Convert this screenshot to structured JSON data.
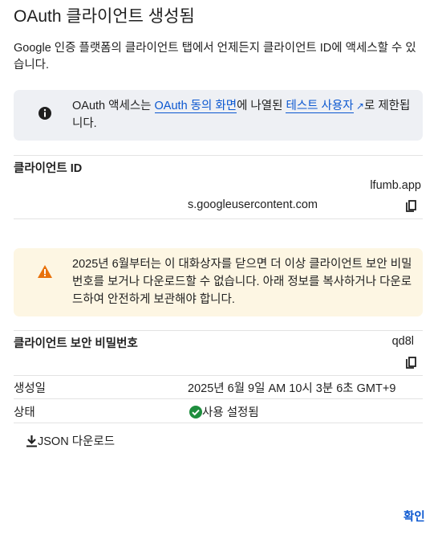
{
  "dialog": {
    "title": "OAuth 클라이언트 생성됨",
    "description": "Google 인증 플랫폼의 클라이언트 탭에서 언제든지 클라이언트 ID에 액세스할 수 있습니다."
  },
  "info": {
    "icon": "info-icon",
    "text_pre": "OAuth 액세스는 ",
    "link1": "OAuth 동의 화면",
    "text_mid": "에 나열된 ",
    "link2": "테스트 사용자",
    "text_post": "로 제한됩니다."
  },
  "client_id": {
    "label": "클라이언트 ID",
    "line1": "lfumb.app",
    "line2": "s.googleusercontent.com"
  },
  "warning": {
    "icon": "warning-icon",
    "text": "2025년 6월부터는 이 대화상자를 닫으면 더 이상 클라이언트 보안 비밀번호를 보거나 다운로드할 수 없습니다. 아래 정보를 복사하거나 다운로드하여 안전하게 보관해야 합니다."
  },
  "secret": {
    "label": "클라이언트 보안 비밀번호",
    "value": "qd8l"
  },
  "created": {
    "label": "생성일",
    "value": "2025년 6월 9일 AM 10시 3분 6초 GMT+9"
  },
  "status": {
    "label": "상태",
    "value": "사용 설정됨",
    "color": "#1e8e3e"
  },
  "download_label": "JSON 다운로드",
  "ok_label": "확인"
}
